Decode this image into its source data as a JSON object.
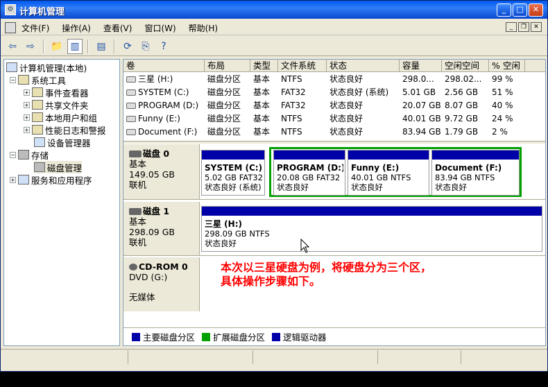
{
  "window": {
    "title": "计算机管理"
  },
  "menu": [
    "文件(F)",
    "操作(A)",
    "查看(V)",
    "窗口(W)",
    "帮助(H)"
  ],
  "toolbar": {
    "icons": [
      "back-icon",
      "forward-icon",
      "up-folder-icon",
      "show-hide-tree-icon",
      "properties-icon",
      "refresh-icon",
      "export-icon",
      "help-icon"
    ]
  },
  "tree": {
    "root": "计算机管理(本地)",
    "system_tools": "系统工具",
    "event_viewer": "事件查看器",
    "shared_folders": "共享文件夹",
    "local_users": "本地用户和组",
    "perf_logs": "性能日志和警报",
    "device_manager": "设备管理器",
    "storage": "存储",
    "disk_management": "磁盘管理",
    "services_apps": "服务和应用程序"
  },
  "volume_table": {
    "headers": [
      "卷",
      "布局",
      "类型",
      "文件系统",
      "状态",
      "容量",
      "空闲空间",
      "% 空闲"
    ],
    "rows": [
      [
        "三星 (H:)",
        "磁盘分区",
        "基本",
        "NTFS",
        "状态良好",
        "298.0...",
        "298.02...",
        "99 %"
      ],
      [
        "SYSTEM (C:)",
        "磁盘分区",
        "基本",
        "FAT32",
        "状态良好 (系统)",
        "5.01 GB",
        "2.56 GB",
        "51 %"
      ],
      [
        "PROGRAM (D:)",
        "磁盘分区",
        "基本",
        "FAT32",
        "状态良好",
        "20.07 GB",
        "8.07 GB",
        "40 %"
      ],
      [
        "Funny (E:)",
        "磁盘分区",
        "基本",
        "NTFS",
        "状态良好",
        "40.01 GB",
        "9.72 GB",
        "24 %"
      ],
      [
        "Document (F:)",
        "磁盘分区",
        "基本",
        "NTFS",
        "状态良好",
        "83.94 GB",
        "1.79 GB",
        "2 %"
      ]
    ]
  },
  "disks": {
    "disk0": {
      "name": "磁盘 0",
      "type": "基本",
      "size": "149.05 GB",
      "status": "联机",
      "parts": [
        {
          "title": "SYSTEM (C:)",
          "detail": "5.02 GB FAT32",
          "status": "状态良好 (系统)"
        },
        {
          "title": "PROGRAM (D:)",
          "detail": "20.08 GB FAT32",
          "status": "状态良好"
        },
        {
          "title": "Funny (E:)",
          "detail": "40.01 GB NTFS",
          "status": "状态良好"
        },
        {
          "title": "Document (F:)",
          "detail": "83.94 GB NTFS",
          "status": "状态良好"
        }
      ]
    },
    "disk1": {
      "name": "磁盘 1",
      "type": "基本",
      "size": "298.09 GB",
      "status": "联机",
      "parts": [
        {
          "title": "三星 (H:)",
          "detail": "298.09 GB NTFS",
          "status": "状态良好"
        }
      ]
    },
    "cdrom": {
      "name": "CD-ROM 0",
      "type": "DVD (G:)",
      "status": "无媒体"
    }
  },
  "instruction": {
    "line1": "本次以三星硬盘为例，将硬盘分为三个区，",
    "line2": "具体操作步骤如下。"
  },
  "legend": [
    {
      "label": "主要磁盘分区",
      "color": "#0000a8"
    },
    {
      "label": "扩展磁盘分区",
      "color": "#00a000"
    },
    {
      "label": "逻辑驱动器",
      "color": "#0000a8"
    }
  ]
}
